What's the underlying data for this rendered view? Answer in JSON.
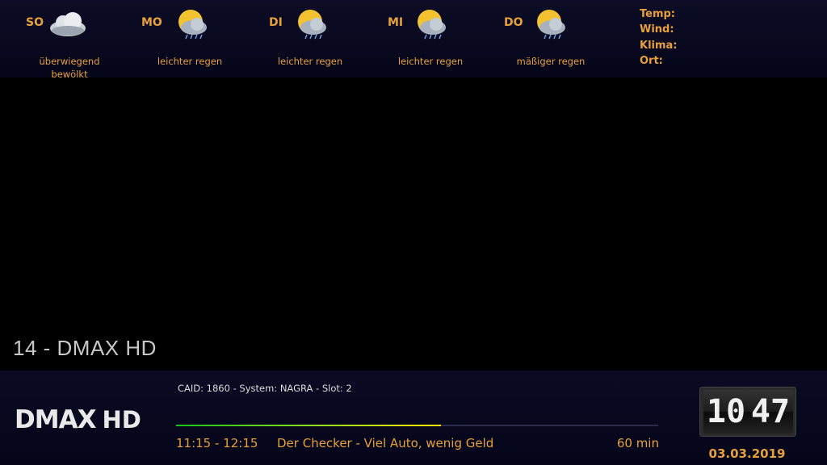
{
  "weather": {
    "days": [
      {
        "code": "SO",
        "desc": "überwiegend bewölkt",
        "icon": "cloud-icon"
      },
      {
        "code": "MO",
        "desc": "leichter regen",
        "icon": "sun-cloud-rain-icon"
      },
      {
        "code": "DI",
        "desc": "leichter regen",
        "icon": "sun-cloud-rain-icon"
      },
      {
        "code": "MI",
        "desc": "leichter regen",
        "icon": "sun-cloud-rain-icon"
      },
      {
        "code": "DO",
        "desc": "mäßiger regen",
        "icon": "sun-cloud-rain-icon"
      }
    ],
    "info_labels": {
      "temp": "Temp:",
      "wind": "Wind:",
      "klima": "Klima:",
      "ort": "Ort:"
    }
  },
  "channel": {
    "name": "14 - DMAX HD",
    "logo_main": "DMAX",
    "logo_suffix": "HD"
  },
  "caid": "CAID: 1860 - System: NAGRA - Slot: 2",
  "progress": {
    "fraction": 0.55
  },
  "next_event": {
    "time": "11:15  -  12:15",
    "title": "Der Checker - Viel Auto, wenig Geld",
    "duration": "60 min"
  },
  "clock": {
    "hour": "10",
    "minute": "47",
    "date": "03.03.2019"
  },
  "colors": {
    "accent": "#e8a13a",
    "background": "#000000",
    "bar": "#08081e"
  }
}
